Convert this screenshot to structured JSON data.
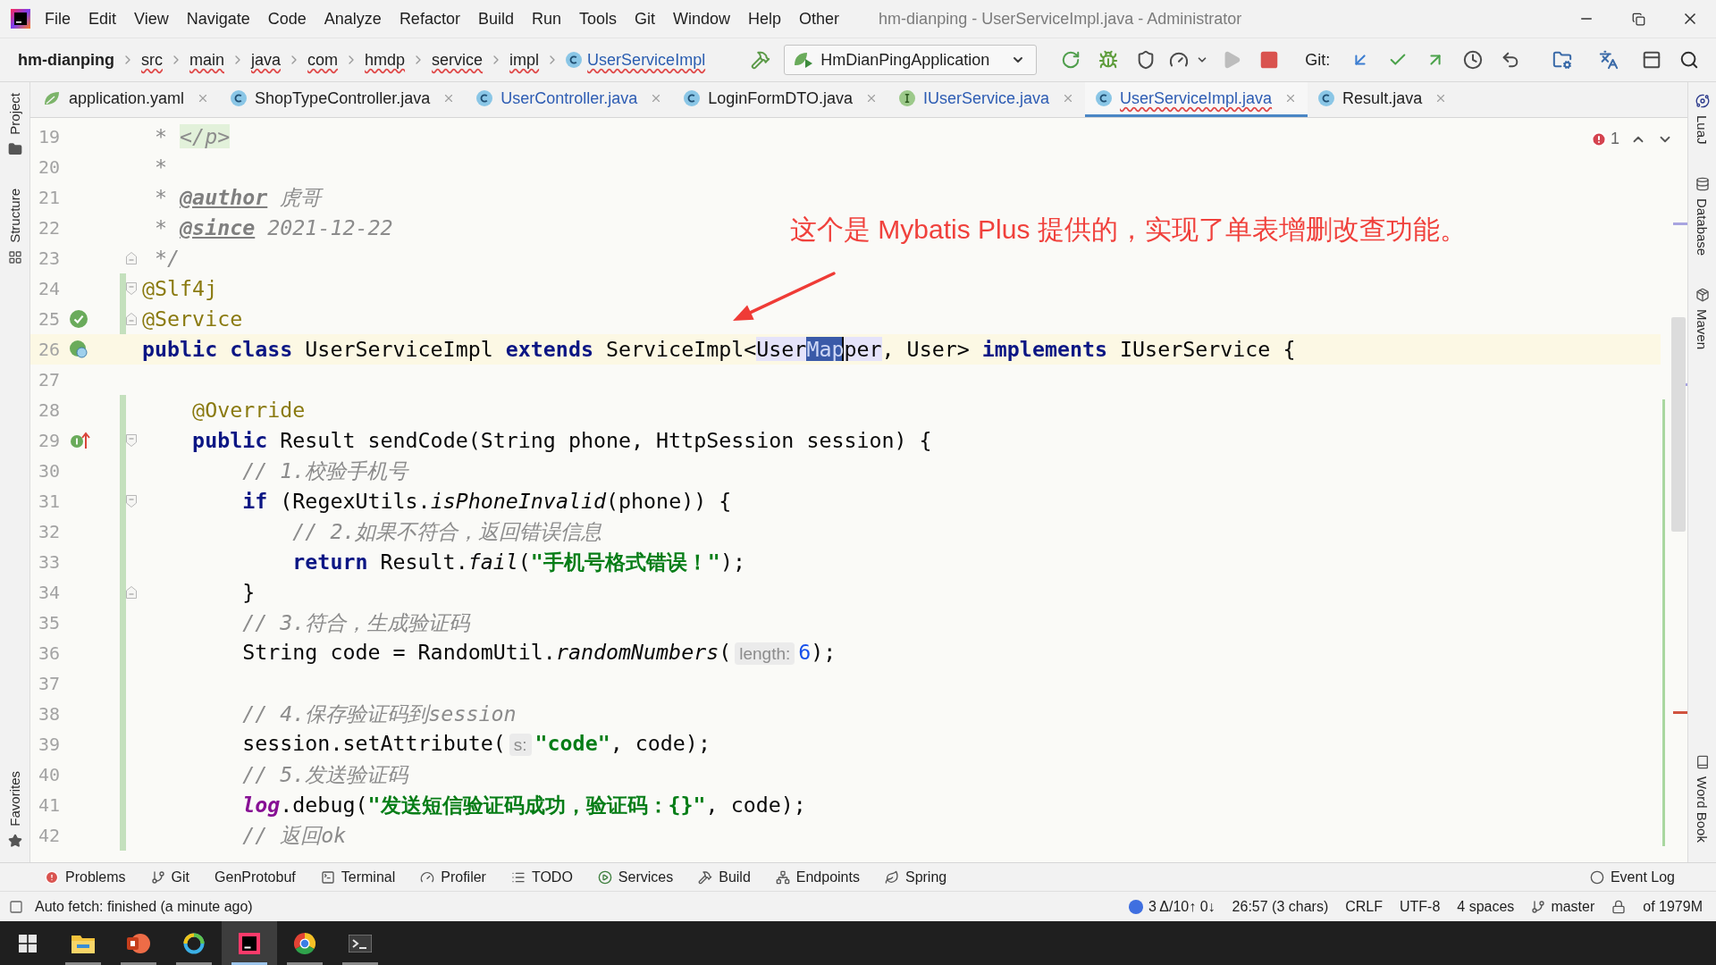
{
  "window": {
    "title": "hm-dianping - UserServiceImpl.java - Administrator"
  },
  "menu": [
    "File",
    "Edit",
    "View",
    "Navigate",
    "Code",
    "Analyze",
    "Refactor",
    "Build",
    "Run",
    "Tools",
    "Git",
    "Window",
    "Help",
    "Other"
  ],
  "breadcrumb": [
    {
      "label": "hm-dianping",
      "kind": "project",
      "error": false
    },
    {
      "label": "src",
      "kind": "folder",
      "error": true
    },
    {
      "label": "main",
      "kind": "folder",
      "error": true
    },
    {
      "label": "java",
      "kind": "folder",
      "error": true
    },
    {
      "label": "com",
      "kind": "folder",
      "error": true
    },
    {
      "label": "hmdp",
      "kind": "folder",
      "error": true
    },
    {
      "label": "service",
      "kind": "folder",
      "error": true
    },
    {
      "label": "impl",
      "kind": "folder",
      "error": true
    },
    {
      "label": "UserServiceImpl",
      "kind": "class",
      "error": true
    }
  ],
  "toolbar": [
    {
      "kind": "build",
      "disabled": false
    },
    {
      "kind": "run-config",
      "label": "HmDianPingApplication"
    },
    {
      "kind": "rerun",
      "disabled": false
    },
    {
      "kind": "debug",
      "disabled": false
    },
    {
      "kind": "coverage",
      "disabled": false
    },
    {
      "kind": "profile",
      "disabled": false
    },
    {
      "kind": "run",
      "disabled": true
    },
    {
      "kind": "stop",
      "disabled": false
    },
    {
      "kind": "label",
      "label": "Git:"
    },
    {
      "kind": "update",
      "disabled": false
    },
    {
      "kind": "commit",
      "disabled": false
    },
    {
      "kind": "push",
      "disabled": false
    },
    {
      "kind": "history",
      "disabled": false
    },
    {
      "kind": "rollback",
      "disabled": false
    },
    {
      "kind": "project-structure",
      "disabled": false
    },
    {
      "kind": "translate",
      "disabled": false
    },
    {
      "kind": "layout",
      "disabled": false
    },
    {
      "kind": "search",
      "disabled": false
    }
  ],
  "left_strip": [
    {
      "label": "Project",
      "kind": "project"
    },
    {
      "label": "Structure",
      "kind": "structure"
    },
    {
      "label": "Favorites",
      "kind": "favorites"
    }
  ],
  "tabs": [
    {
      "label": "application.yaml",
      "kind": "yaml",
      "modified": false,
      "error": false,
      "selected": false
    },
    {
      "label": "ShopTypeController.java",
      "kind": "class",
      "modified": false,
      "error": false,
      "selected": false
    },
    {
      "label": "UserController.java",
      "kind": "class",
      "modified": true,
      "error": false,
      "selected": false
    },
    {
      "label": "LoginFormDTO.java",
      "kind": "class",
      "modified": false,
      "error": false,
      "selected": false
    },
    {
      "label": "IUserService.java",
      "kind": "interface",
      "modified": true,
      "error": false,
      "selected": false
    },
    {
      "label": "UserServiceImpl.java",
      "kind": "class",
      "modified": true,
      "error": true,
      "selected": true
    },
    {
      "label": "Result.java",
      "kind": "class",
      "modified": false,
      "error": false,
      "selected": false
    }
  ],
  "editor": {
    "error_count": "1",
    "lines": [
      {
        "number": "19",
        "current": false,
        "changed": false,
        "tokens": [
          {
            "text": " * ",
            "kind": "comment"
          },
          {
            "text": "</p>",
            "kind": "doc-html"
          }
        ]
      },
      {
        "number": "20",
        "current": false,
        "changed": false,
        "tokens": [
          {
            "text": " *",
            "kind": "comment"
          }
        ]
      },
      {
        "number": "21",
        "current": false,
        "changed": false,
        "tokens": [
          {
            "text": " * ",
            "kind": "comment"
          },
          {
            "text": "@author",
            "kind": "doc-tag"
          },
          {
            "text": " 虎哥",
            "kind": "comment"
          }
        ]
      },
      {
        "number": "22",
        "current": false,
        "changed": false,
        "tokens": [
          {
            "text": " * ",
            "kind": "comment"
          },
          {
            "text": "@since",
            "kind": "doc-tag"
          },
          {
            "text": " 2021-12-22",
            "kind": "comment"
          }
        ]
      },
      {
        "number": "23",
        "current": false,
        "changed": false,
        "fold": {
          "kind": "end"
        },
        "tokens": [
          {
            "text": " */",
            "kind": "comment"
          }
        ]
      },
      {
        "number": "24",
        "current": false,
        "changed": true,
        "fold": {
          "kind": "start"
        },
        "tokens": [
          {
            "text": "@Slf4j",
            "kind": "annotation"
          }
        ]
      },
      {
        "number": "25",
        "current": false,
        "changed": true,
        "fold": {
          "kind": "end"
        },
        "marker": {
          "kind": "bean"
        },
        "tokens": [
          {
            "text": "@Service",
            "kind": "annotation"
          }
        ]
      },
      {
        "number": "26",
        "current": true,
        "changed": false,
        "marker": {
          "kind": "implements"
        },
        "tokens": [
          {
            "text": "public",
            "kind": "keyword"
          },
          {
            "text": " class",
            "kind": "keyword"
          },
          {
            "text": " UserServiceImpl ",
            "kind": "plain"
          },
          {
            "text": "extends",
            "kind": "keyword"
          },
          {
            "text": " ServiceImpl<",
            "kind": "plain"
          },
          {
            "text": "User",
            "kind": "usage"
          },
          {
            "text": "Map",
            "kind": "selection"
          },
          {
            "text": "per",
            "kind": "usage"
          },
          {
            "text": ", User> ",
            "kind": "plain"
          },
          {
            "text": "implements",
            "kind": "keyword"
          },
          {
            "text": " IUserService {",
            "kind": "plain"
          }
        ]
      },
      {
        "number": "27",
        "current": false,
        "changed": false
      },
      {
        "number": "28",
        "current": false,
        "changed": true,
        "tokens": [
          {
            "text": "    @Override",
            "kind": "annotation"
          }
        ]
      },
      {
        "number": "29",
        "current": false,
        "changed": true,
        "fold": {
          "kind": "start"
        },
        "marker": {
          "kind": "override"
        },
        "tokens": [
          {
            "text": "    public",
            "kind": "keyword"
          },
          {
            "text": " Result sendCode(String phone, HttpSession session) {",
            "kind": "plain"
          }
        ]
      },
      {
        "number": "30",
        "current": false,
        "changed": true,
        "tokens": [
          {
            "text": "        // 1.校验手机号",
            "kind": "comment"
          }
        ]
      },
      {
        "number": "31",
        "current": false,
        "changed": true,
        "fold": {
          "kind": "start"
        },
        "tokens": [
          {
            "text": "        if",
            "kind": "keyword"
          },
          {
            "text": " (RegexUtils.",
            "kind": "plain"
          },
          {
            "text": "isPhoneInvalid",
            "kind": "static"
          },
          {
            "text": "(phone)) {",
            "kind": "plain"
          }
        ]
      },
      {
        "number": "32",
        "current": false,
        "changed": true,
        "tokens": [
          {
            "text": "            // 2.如果不符合，返回错误信息",
            "kind": "comment"
          }
        ]
      },
      {
        "number": "33",
        "current": false,
        "changed": true,
        "tokens": [
          {
            "text": "            return",
            "kind": "keyword"
          },
          {
            "text": " Result.",
            "kind": "plain"
          },
          {
            "text": "fail",
            "kind": "static"
          },
          {
            "text": "(",
            "kind": "plain"
          },
          {
            "text": "\"手机号格式错误！\"",
            "kind": "string"
          },
          {
            "text": ");",
            "kind": "plain"
          }
        ]
      },
      {
        "number": "34",
        "current": false,
        "changed": true,
        "fold": {
          "kind": "end"
        },
        "tokens": [
          {
            "text": "        }",
            "kind": "plain"
          }
        ]
      },
      {
        "number": "35",
        "current": false,
        "changed": true,
        "tokens": [
          {
            "text": "        // 3.符合，生成验证码",
            "kind": "comment"
          }
        ]
      },
      {
        "number": "36",
        "current": false,
        "changed": true,
        "tokens": [
          {
            "text": "        String code = RandomUtil.",
            "kind": "plain"
          },
          {
            "text": "randomNumbers",
            "kind": "static"
          },
          {
            "text": "(",
            "kind": "plain"
          },
          {
            "text": "length:",
            "kind": "hint"
          },
          {
            "text": "6",
            "kind": "number"
          },
          {
            "text": ");",
            "kind": "plain"
          }
        ]
      },
      {
        "number": "37",
        "current": false,
        "changed": true
      },
      {
        "number": "38",
        "current": false,
        "changed": true,
        "tokens": [
          {
            "text": "        // 4.保存验证码到session",
            "kind": "comment"
          }
        ]
      },
      {
        "number": "39",
        "current": false,
        "changed": true,
        "tokens": [
          {
            "text": "        session.setAttribute(",
            "kind": "plain"
          },
          {
            "text": "s:",
            "kind": "hint"
          },
          {
            "text": "\"code\"",
            "kind": "string"
          },
          {
            "text": ", code);",
            "kind": "plain"
          }
        ]
      },
      {
        "number": "40",
        "current": false,
        "changed": true,
        "tokens": [
          {
            "text": "        // 5.发送验证码",
            "kind": "comment"
          }
        ]
      },
      {
        "number": "41",
        "current": false,
        "changed": true,
        "tokens": [
          {
            "text": "        log",
            "kind": "field"
          },
          {
            "text": ".debug(",
            "kind": "plain"
          },
          {
            "text": "\"发送短信验证码成功，验证码：{}\"",
            "kind": "string"
          },
          {
            "text": ", code);",
            "kind": "plain"
          }
        ]
      },
      {
        "number": "42",
        "current": false,
        "changed": true,
        "tokens": [
          {
            "text": "        // 返回ok",
            "kind": "comment"
          }
        ]
      }
    ]
  },
  "annotation": {
    "text": "这个是 Mybatis Plus 提供的，实现了单表增删改查功能。"
  },
  "right_strip": [
    {
      "label": "LuaJ",
      "kind": "luaj"
    },
    {
      "label": "Database",
      "kind": "database"
    },
    {
      "label": "Maven",
      "kind": "maven"
    },
    {
      "label": "Word Book",
      "kind": "wordbook"
    }
  ],
  "tool_windows": [
    {
      "label": "Problems",
      "kind": "problems"
    },
    {
      "label": "Git",
      "kind": "git"
    },
    {
      "label": "GenProtobuf",
      "kind": "plain"
    },
    {
      "label": "Terminal",
      "kind": "terminal"
    },
    {
      "label": "Profiler",
      "kind": "profiler"
    },
    {
      "label": "TODO",
      "kind": "todo"
    },
    {
      "label": "Services",
      "kind": "services"
    },
    {
      "label": "Build",
      "kind": "build"
    },
    {
      "label": "Endpoints",
      "kind": "endpoints"
    },
    {
      "label": "Spring",
      "kind": "spring"
    },
    {
      "label": "Event Log",
      "kind": "event-log"
    }
  ],
  "status_bar": {
    "message": "Auto fetch: finished (a minute ago)",
    "items": [
      {
        "text": "3 Δ/10↑ 0↓",
        "kind": "vcs"
      },
      {
        "text": "26:57 (3 chars)",
        "kind": "plain"
      },
      {
        "text": "CRLF",
        "kind": "plain"
      },
      {
        "text": "UTF-8",
        "kind": "plain"
      },
      {
        "text": "4 spaces",
        "kind": "plain"
      },
      {
        "text": "master",
        "kind": "branch"
      },
      {
        "kind": "lock"
      },
      {
        "text": "of 1979M",
        "kind": "memory"
      }
    ]
  },
  "taskbar": [
    {
      "kind": "start",
      "running": false,
      "selected": false
    },
    {
      "kind": "explorer",
      "running": true,
      "selected": false
    },
    {
      "kind": "presentation",
      "running": true,
      "selected": false
    },
    {
      "kind": "ring",
      "running": true,
      "selected": false
    },
    {
      "kind": "ide",
      "running": true,
      "selected": true
    },
    {
      "kind": "browser",
      "running": true,
      "selected": false
    },
    {
      "kind": "terminal",
      "running": true,
      "selected": false
    }
  ]
}
